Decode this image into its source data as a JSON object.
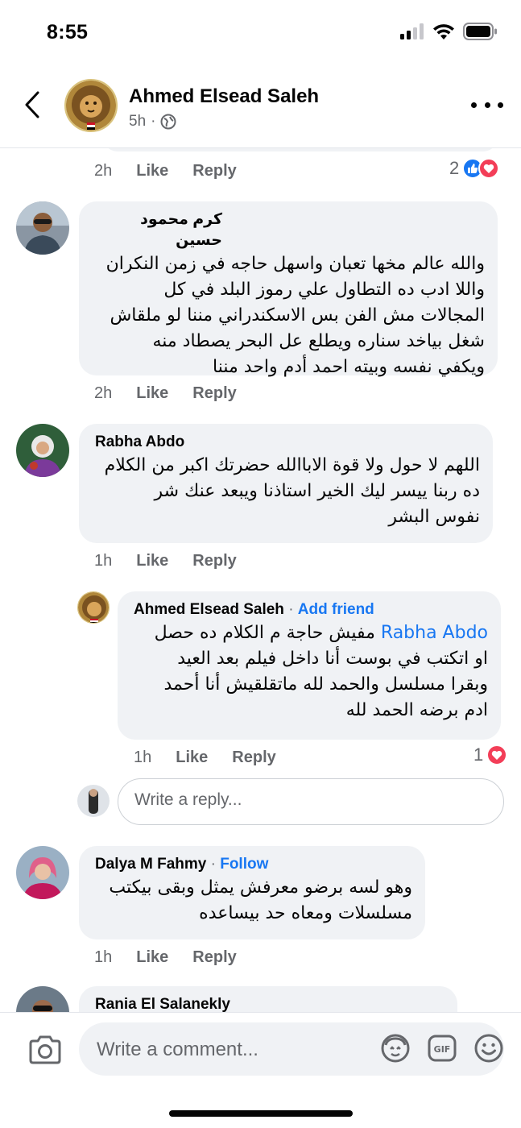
{
  "status_bar": {
    "time": "8:55"
  },
  "header": {
    "name": "Ahmed Elsead Saleh",
    "time": "5h",
    "separator": "·"
  },
  "top_actions": {
    "time": "2h",
    "like": "Like",
    "reply": "Reply",
    "reaction_count": "2"
  },
  "comments": [
    {
      "author": "كرم محمود حسين",
      "text_lines": [
        "والله عالم مخها تعبان واسهل حاجه في زمن النكران",
        "واللا ادب ده التطاول علي رموز البلد في كل",
        "المجالات مش الفن بس الاسكندراني مننا لو ملقاش",
        "شغل بياخد سناره ويطلع عل البحر يصطاد منه",
        "ويكفي نفسه وبيته احمد أدم واحد مننا"
      ],
      "time": "2h",
      "like": "Like",
      "reply": "Reply"
    },
    {
      "author": "Rabha Abdo",
      "text_lines": [
        "اللهم لا حول ولا قوة الاباالله حضرتك اكبر من الكلام",
        "ده ربنا ييسر ليك الخير استاذنا ويبعد عنك شر",
        "نفوس البشر"
      ],
      "time": "1h",
      "like": "Like",
      "reply": "Reply"
    },
    {
      "author": "Dalya M Fahmy",
      "follow": "Follow",
      "text_lines": [
        "وهو لسه برضو معرفش يمثل وبقى بيكتب",
        "مسلسلات ومعاه حد بيساعده"
      ],
      "time": "1h",
      "like": "Like",
      "reply": "Reply"
    },
    {
      "author": "Rania El Salanekly"
    }
  ],
  "reply": {
    "author": "Ahmed Elsead Saleh",
    "add_friend": "Add friend",
    "mention": "Rabha Abdo",
    "first_line_rest": "مفيش حاجة م الكلام ده حصل",
    "text_lines": [
      "او اتكتب في بوست أنا داخل فيلم بعد العيد",
      "وبقرا مسلسل والحمد لله ماتقلقيش أنا أحمد",
      "ادم برضه الحمد لله"
    ],
    "time": "1h",
    "like": "Like",
    "reply": "Reply",
    "reaction_count": "1"
  },
  "reply_box": {
    "placeholder": "Write a reply..."
  },
  "composer": {
    "placeholder": "Write a comment..."
  },
  "colors": {
    "link_blue": "#1877f2",
    "bubble_bg": "#f0f2f5",
    "meta_gray": "#65676b",
    "love_red": "#f33e58"
  }
}
